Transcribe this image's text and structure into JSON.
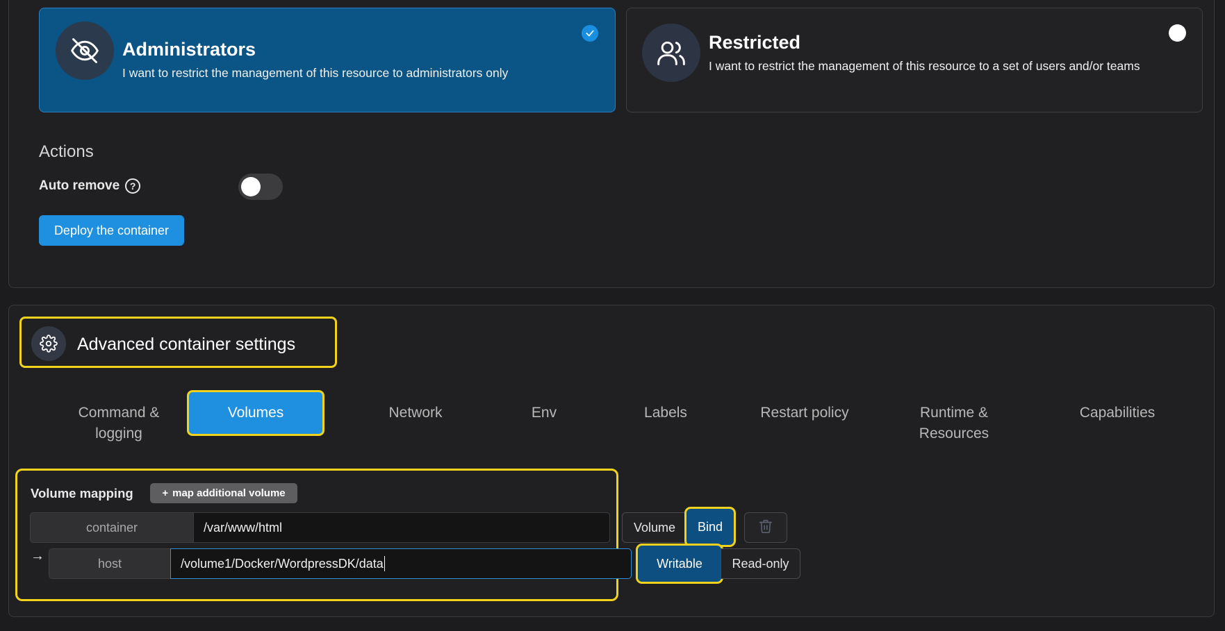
{
  "access_control": {
    "administrators": {
      "title": "Administrators",
      "description": "I want to restrict the management of this resource to administrators only",
      "icon": "eye-off-icon",
      "selected": true
    },
    "restricted": {
      "title": "Restricted",
      "description": "I want to restrict the management of this resource to a set of users and/or teams",
      "icon": "users-icon",
      "selected": false
    }
  },
  "actions": {
    "heading": "Actions",
    "auto_remove_label": "Auto remove",
    "auto_remove_help_icon": "help-circle-icon",
    "auto_remove_on": false,
    "deploy_label": "Deploy the container"
  },
  "advanced": {
    "title": "Advanced container settings",
    "icon": "gear-icon",
    "tabs": [
      {
        "label": "Command & logging"
      },
      {
        "label": "Volumes",
        "active": true
      },
      {
        "label": "Network"
      },
      {
        "label": "Env"
      },
      {
        "label": "Labels"
      },
      {
        "label": "Restart policy"
      },
      {
        "label": "Runtime & Resources"
      },
      {
        "label": "Capabilities"
      }
    ]
  },
  "volume_mapping": {
    "label": "Volume mapping",
    "add_label": "map additional volume",
    "container_addon": "container",
    "container_value": "/var/www/html",
    "host_addon": "host",
    "host_value": "/volume1/Docker/WordpressDK/data",
    "type_options": [
      "Volume",
      "Bind"
    ],
    "type_selected": "Bind",
    "mode_options": [
      "Writable",
      "Read-only"
    ],
    "mode_selected": "Writable"
  },
  "colors": {
    "accent": "#1f8fe0",
    "highlight": "#f1d21d",
    "selected_card": "#0a5585"
  }
}
